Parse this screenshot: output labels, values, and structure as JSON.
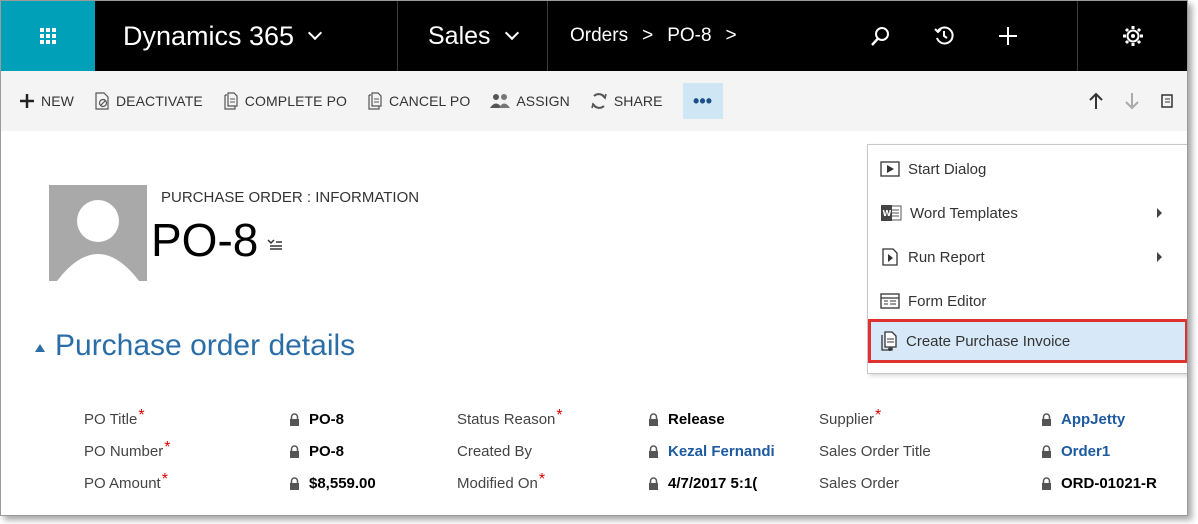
{
  "topnav": {
    "app_name": "Dynamics 365",
    "area": "Sales",
    "crumb_entity": "Orders",
    "crumb_sep": ">",
    "crumb_record": "PO-8",
    "icons": [
      "app-launcher-icon",
      "search-icon",
      "history-icon",
      "plus-icon",
      "gear-icon"
    ]
  },
  "commands": [
    {
      "label": "NEW",
      "icon": "plus-icon"
    },
    {
      "label": "DEACTIVATE",
      "icon": "deactivate-icon"
    },
    {
      "label": "COMPLETE PO",
      "icon": "document-icon"
    },
    {
      "label": "CANCEL PO",
      "icon": "document-icon"
    },
    {
      "label": "ASSIGN",
      "icon": "people-icon"
    },
    {
      "label": "SHARE",
      "icon": "share-icon"
    }
  ],
  "more_label": "•••",
  "header": {
    "entity_form": "PURCHASE ORDER : INFORMATION",
    "record_name": "PO-8"
  },
  "section": {
    "title": "Purchase order details"
  },
  "fields": {
    "col1": [
      {
        "label": "PO Title",
        "required": "*",
        "value": "PO-8"
      },
      {
        "label": "PO Number",
        "required": "*",
        "value": "PO-8"
      },
      {
        "label": "PO Amount",
        "required": "*",
        "value": "$8,559.00"
      }
    ],
    "col2": [
      {
        "label": "Status Reason",
        "required": "*",
        "value": "Release"
      },
      {
        "label": "Created By",
        "required": "",
        "value": "Kezal Fernandi"
      },
      {
        "label": "Modified On",
        "required": "*",
        "value": "4/7/2017  5:1("
      }
    ],
    "col3": [
      {
        "label": "Supplier",
        "required": "*",
        "value": "AppJetty"
      },
      {
        "label": "Sales Order Title",
        "required": "",
        "value": "Order1"
      },
      {
        "label": "Sales Order",
        "required": "",
        "value": "ORD-01021-R"
      }
    ]
  },
  "menu": [
    {
      "label": "Start Dialog",
      "icon": "dialog-icon"
    },
    {
      "label": "Word Templates",
      "icon": "word-icon"
    },
    {
      "label": "Run Report",
      "icon": "report-icon"
    },
    {
      "label": "Form Editor",
      "icon": "form-editor-icon"
    },
    {
      "label": "Create Purchase Invoice",
      "icon": "invoice-icon"
    }
  ],
  "colors": {
    "accent": "#00a0b8",
    "link": "#1d5aa0",
    "required": "#e00000",
    "highlight": "#d7e9f8",
    "callout": "#e03131"
  }
}
